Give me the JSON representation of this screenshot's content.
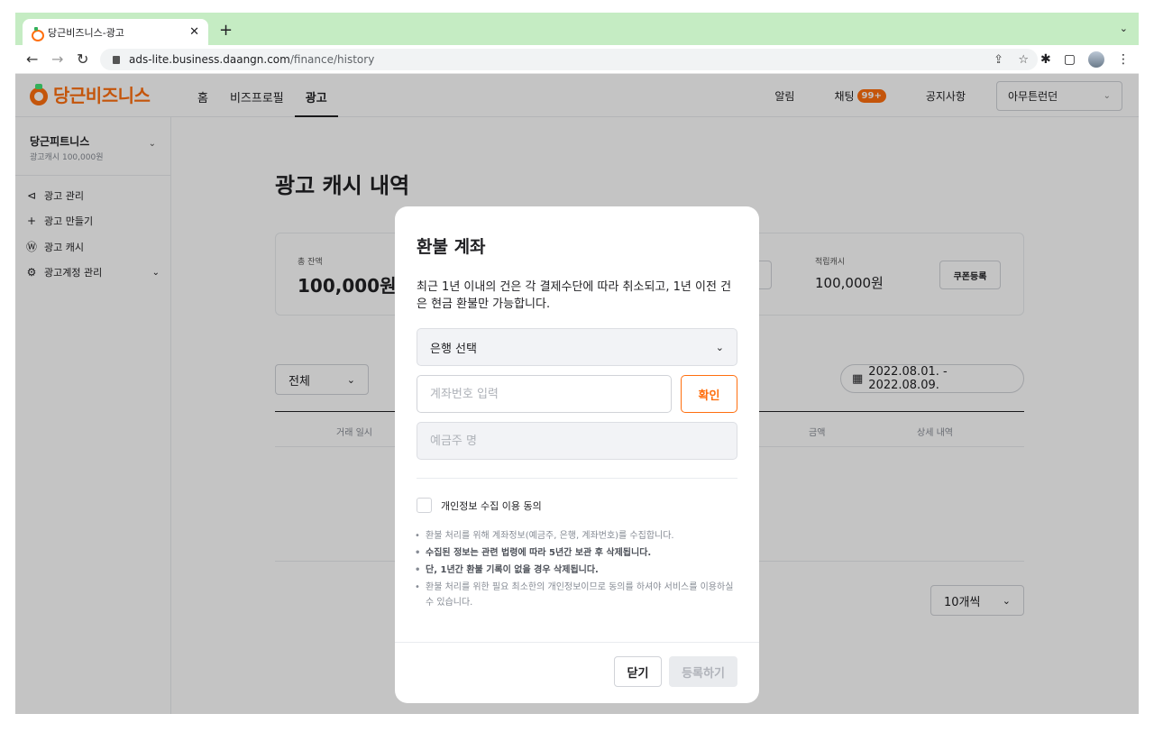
{
  "browser": {
    "tab_title": "당근비즈니스-광고",
    "url_host": "ads-lite.business.daangn.com",
    "url_path": "/finance/history"
  },
  "header": {
    "logo_text": "당근비즈니스",
    "nav": [
      "홈",
      "비즈프로필",
      "광고"
    ],
    "active_nav": "광고",
    "alerts_label": "알림",
    "chat_label": "채팅",
    "chat_badge": "99+",
    "notice_label": "공지사항",
    "account_select": "아무튼런던"
  },
  "sidebar": {
    "business_name": "당근피트니스",
    "business_sub": "광고캐시 100,000원",
    "items": [
      {
        "label": "광고 관리",
        "icon": "megaphone-icon"
      },
      {
        "label": "광고 만들기",
        "icon": "plus-icon"
      },
      {
        "label": "광고 캐시",
        "icon": "won-icon"
      },
      {
        "label": "광고계정 관리",
        "icon": "gear-icon"
      }
    ]
  },
  "main": {
    "title": "광고 캐시 내역",
    "balance_label": "총 잔액",
    "balance_value": "100,000원",
    "reward_label": "적립캐시",
    "reward_value": "100,000원",
    "coupon_button": "쿠폰등록",
    "filter_select": "전체",
    "date_range": "2022.08.01. - 2022.08.09.",
    "columns": [
      "거래 일시",
      "금액",
      "상세 내역"
    ],
    "per_page": "10개씩"
  },
  "modal": {
    "title": "환불 계좌",
    "description": "최근 1년 이내의 건은 각 결제수단에 따라 취소되고, 1년 이전 건은 현금 환불만 가능합니다.",
    "bank_select": "은행 선택",
    "account_placeholder": "계좌번호 입력",
    "confirm_button": "확인",
    "holder_placeholder": "예금주 명",
    "consent_label": "개인정보 수집 이용 동의",
    "notes": [
      "환불 처리를 위해 계좌정보(예금주, 은행, 계좌번호)를 수집합니다.",
      "수집된 정보는 관련 법령에 따라 5년간 보관 후 삭제됩니다.",
      "단, 1년간 환불 기록이 없을 경우 삭제됩니다.",
      "환불 처리를 위한 필요 최소한의 개인정보이므로 동의를 하셔야 서비스를 이용하실 수 있습니다."
    ],
    "close_button": "닫기",
    "register_button": "등록하기"
  },
  "colors": {
    "brand": "#ff6f0f",
    "tab_strip": "#c5ecc3",
    "overlay": "rgba(0,0,0,0.23)"
  }
}
